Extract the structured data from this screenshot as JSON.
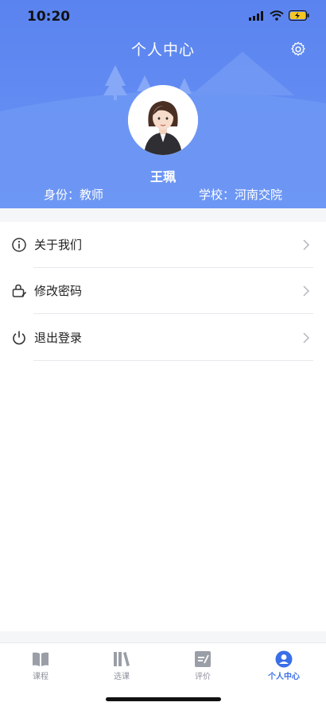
{
  "status_bar": {
    "time": "10:20"
  },
  "header": {
    "title": "个人中心",
    "settings_icon": "gear-icon",
    "background_color": "#5a83ef"
  },
  "profile": {
    "name": "王珮",
    "role_text": "身份：教师",
    "school_text": "学校：河南交院"
  },
  "menu": {
    "items": [
      {
        "label": "关于我们",
        "icon": "info-icon"
      },
      {
        "label": "修改密码",
        "icon": "lock-edit-icon"
      },
      {
        "label": "退出登录",
        "icon": "power-icon"
      }
    ]
  },
  "tabbar": {
    "accent_color": "#3b6fe8",
    "tabs": [
      {
        "label": "课程",
        "icon": "book-icon",
        "active": false
      },
      {
        "label": "选课",
        "icon": "books-icon",
        "active": false
      },
      {
        "label": "评价",
        "icon": "edit-note-icon",
        "active": false
      },
      {
        "label": "个人中心",
        "icon": "user-icon",
        "active": true
      }
    ]
  }
}
